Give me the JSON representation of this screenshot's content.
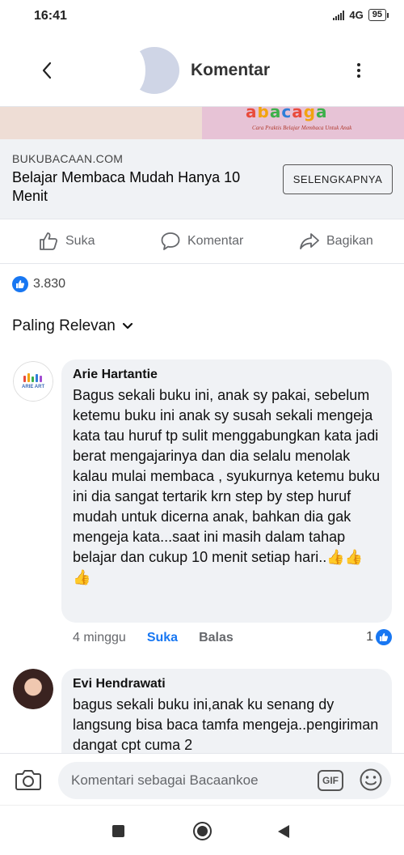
{
  "status_bar": {
    "time": "16:41",
    "network": "4G",
    "battery": "95"
  },
  "header": {
    "title": "Komentar"
  },
  "banner": {
    "logo_text": "abacaga",
    "tagline": "Cara Praktis Belajar Membaca Untuk Anak"
  },
  "link_preview": {
    "domain": "BUKUBACAAN.COM",
    "title": "Belajar Membaca Mudah Hanya 10 Menit",
    "cta": "SELENGKAPNYA"
  },
  "actions": {
    "like": "Suka",
    "comment": "Komentar",
    "share": "Bagikan"
  },
  "reactions": {
    "count": "3.830"
  },
  "sort": {
    "label": "Paling Relevan"
  },
  "comments": [
    {
      "author": "Arie Hartantie",
      "avatar_text": "ARIE ART",
      "text": "Bagus sekali buku ini, anak sy pakai, sebelum ketemu buku ini anak sy susah sekali mengeja kata  tau huruf tp sulit menggabungkan kata jadi berat mengajarinya dan dia selalu menolak kalau mulai membaca , syukurnya ketemu buku ini dia sangat tertarik krn step by step huruf mudah untuk dicerna anak, bahkan dia gak mengeja kata...saat ini masih dalam tahap belajar dan cukup 10 menit setiap hari..👍👍👍",
      "time": "4 minggu",
      "like_label": "Suka",
      "reply_label": "Balas",
      "likes": "1"
    },
    {
      "author": "Evi Hendrawati",
      "text": "bagus sekali buku ini,anak ku senang dy langsung bisa baca tamfa mengeja..pengiriman dangat cpt cuma 2"
    }
  ],
  "compose": {
    "placeholder": "Komentari sebagai Bacaankoe",
    "gif": "GIF"
  },
  "colors": {
    "accent": "#1877f2",
    "bubble": "#f0f2f5",
    "muted_text": "#65676b"
  }
}
